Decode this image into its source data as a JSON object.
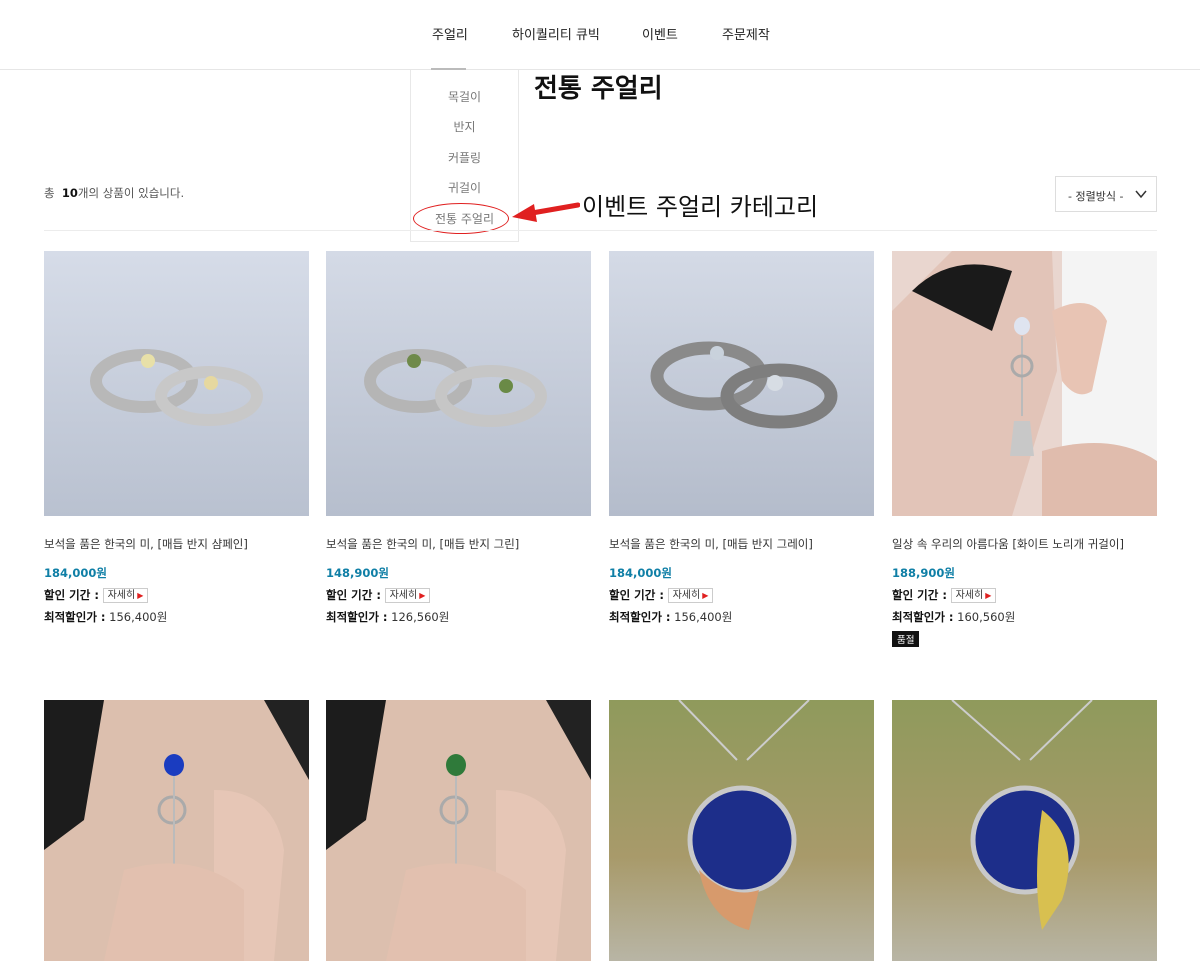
{
  "nav": {
    "items": [
      "주얼리",
      "하이퀄리티 큐빅",
      "이벤트",
      "주문제작"
    ]
  },
  "dropdown": {
    "items": [
      "목걸이",
      "반지",
      "커플링",
      "귀걸이",
      "전통 주얼리"
    ]
  },
  "page": {
    "title": "전통 주얼리",
    "callout": "이벤트 주얼리 카테고리",
    "count_prefix": "총",
    "count_value": "10",
    "count_suffix": "개의 상품이 있습니다.",
    "sort_label": "- 정렬방식 -"
  },
  "labels": {
    "discount_period": "할인 기간 :",
    "detail": "자세히",
    "best_price": "최적할인가 :"
  },
  "products": [
    {
      "name": "보석을 품은 한국의 미, [매듭 반지 샴페인]",
      "price": "184,000원",
      "best": "156,400원",
      "soldout": ""
    },
    {
      "name": "보석을 품은 한국의 미, [매듭 반지 그린]",
      "price": "148,900원",
      "best": "126,560원",
      "soldout": ""
    },
    {
      "name": "보석을 품은 한국의 미, [매듭 반지 그레이]",
      "price": "184,000원",
      "best": "156,400원",
      "soldout": ""
    },
    {
      "name": "일상 속 우리의 아름다움 [화이트 노리개 귀걸이]",
      "price": "188,900원",
      "best": "160,560원",
      "soldout": "품절"
    }
  ],
  "colors": {
    "accent_price": "#0f7fa6",
    "annotation_red": "#e02020"
  }
}
